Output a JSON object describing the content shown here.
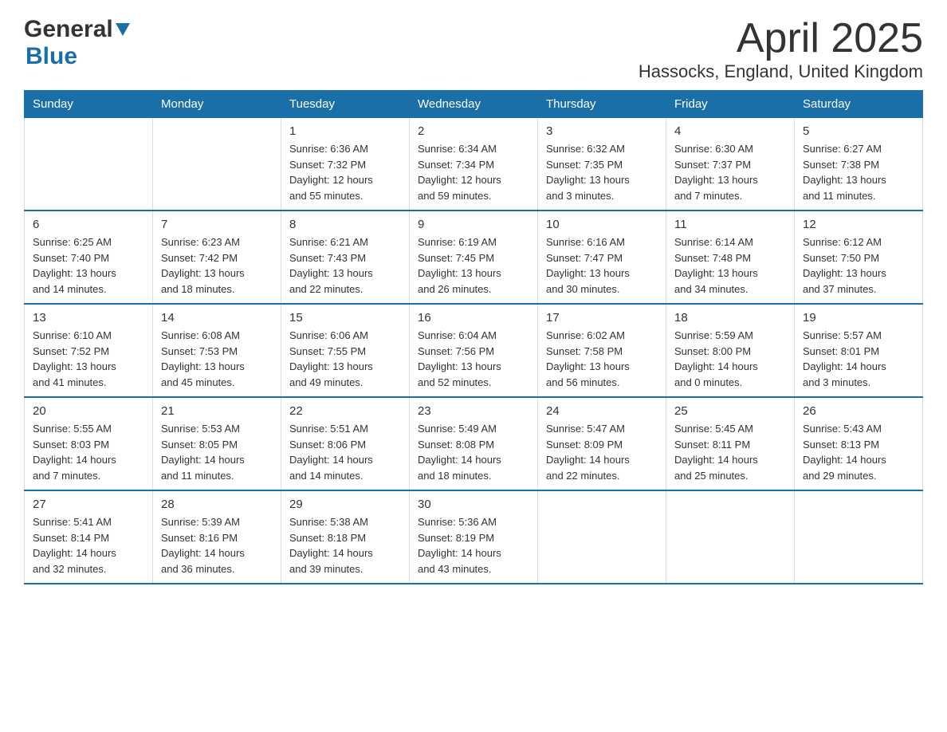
{
  "header": {
    "logo": {
      "general_text": "General",
      "blue_text": "Blue"
    },
    "title": "April 2025",
    "subtitle": "Hassocks, England, United Kingdom"
  },
  "calendar": {
    "days_of_week": [
      "Sunday",
      "Monday",
      "Tuesday",
      "Wednesday",
      "Thursday",
      "Friday",
      "Saturday"
    ],
    "weeks": [
      [
        {
          "day": "",
          "info": ""
        },
        {
          "day": "",
          "info": ""
        },
        {
          "day": "1",
          "info": "Sunrise: 6:36 AM\nSunset: 7:32 PM\nDaylight: 12 hours\nand 55 minutes."
        },
        {
          "day": "2",
          "info": "Sunrise: 6:34 AM\nSunset: 7:34 PM\nDaylight: 12 hours\nand 59 minutes."
        },
        {
          "day": "3",
          "info": "Sunrise: 6:32 AM\nSunset: 7:35 PM\nDaylight: 13 hours\nand 3 minutes."
        },
        {
          "day": "4",
          "info": "Sunrise: 6:30 AM\nSunset: 7:37 PM\nDaylight: 13 hours\nand 7 minutes."
        },
        {
          "day": "5",
          "info": "Sunrise: 6:27 AM\nSunset: 7:38 PM\nDaylight: 13 hours\nand 11 minutes."
        }
      ],
      [
        {
          "day": "6",
          "info": "Sunrise: 6:25 AM\nSunset: 7:40 PM\nDaylight: 13 hours\nand 14 minutes."
        },
        {
          "day": "7",
          "info": "Sunrise: 6:23 AM\nSunset: 7:42 PM\nDaylight: 13 hours\nand 18 minutes."
        },
        {
          "day": "8",
          "info": "Sunrise: 6:21 AM\nSunset: 7:43 PM\nDaylight: 13 hours\nand 22 minutes."
        },
        {
          "day": "9",
          "info": "Sunrise: 6:19 AM\nSunset: 7:45 PM\nDaylight: 13 hours\nand 26 minutes."
        },
        {
          "day": "10",
          "info": "Sunrise: 6:16 AM\nSunset: 7:47 PM\nDaylight: 13 hours\nand 30 minutes."
        },
        {
          "day": "11",
          "info": "Sunrise: 6:14 AM\nSunset: 7:48 PM\nDaylight: 13 hours\nand 34 minutes."
        },
        {
          "day": "12",
          "info": "Sunrise: 6:12 AM\nSunset: 7:50 PM\nDaylight: 13 hours\nand 37 minutes."
        }
      ],
      [
        {
          "day": "13",
          "info": "Sunrise: 6:10 AM\nSunset: 7:52 PM\nDaylight: 13 hours\nand 41 minutes."
        },
        {
          "day": "14",
          "info": "Sunrise: 6:08 AM\nSunset: 7:53 PM\nDaylight: 13 hours\nand 45 minutes."
        },
        {
          "day": "15",
          "info": "Sunrise: 6:06 AM\nSunset: 7:55 PM\nDaylight: 13 hours\nand 49 minutes."
        },
        {
          "day": "16",
          "info": "Sunrise: 6:04 AM\nSunset: 7:56 PM\nDaylight: 13 hours\nand 52 minutes."
        },
        {
          "day": "17",
          "info": "Sunrise: 6:02 AM\nSunset: 7:58 PM\nDaylight: 13 hours\nand 56 minutes."
        },
        {
          "day": "18",
          "info": "Sunrise: 5:59 AM\nSunset: 8:00 PM\nDaylight: 14 hours\nand 0 minutes."
        },
        {
          "day": "19",
          "info": "Sunrise: 5:57 AM\nSunset: 8:01 PM\nDaylight: 14 hours\nand 3 minutes."
        }
      ],
      [
        {
          "day": "20",
          "info": "Sunrise: 5:55 AM\nSunset: 8:03 PM\nDaylight: 14 hours\nand 7 minutes."
        },
        {
          "day": "21",
          "info": "Sunrise: 5:53 AM\nSunset: 8:05 PM\nDaylight: 14 hours\nand 11 minutes."
        },
        {
          "day": "22",
          "info": "Sunrise: 5:51 AM\nSunset: 8:06 PM\nDaylight: 14 hours\nand 14 minutes."
        },
        {
          "day": "23",
          "info": "Sunrise: 5:49 AM\nSunset: 8:08 PM\nDaylight: 14 hours\nand 18 minutes."
        },
        {
          "day": "24",
          "info": "Sunrise: 5:47 AM\nSunset: 8:09 PM\nDaylight: 14 hours\nand 22 minutes."
        },
        {
          "day": "25",
          "info": "Sunrise: 5:45 AM\nSunset: 8:11 PM\nDaylight: 14 hours\nand 25 minutes."
        },
        {
          "day": "26",
          "info": "Sunrise: 5:43 AM\nSunset: 8:13 PM\nDaylight: 14 hours\nand 29 minutes."
        }
      ],
      [
        {
          "day": "27",
          "info": "Sunrise: 5:41 AM\nSunset: 8:14 PM\nDaylight: 14 hours\nand 32 minutes."
        },
        {
          "day": "28",
          "info": "Sunrise: 5:39 AM\nSunset: 8:16 PM\nDaylight: 14 hours\nand 36 minutes."
        },
        {
          "day": "29",
          "info": "Sunrise: 5:38 AM\nSunset: 8:18 PM\nDaylight: 14 hours\nand 39 minutes."
        },
        {
          "day": "30",
          "info": "Sunrise: 5:36 AM\nSunset: 8:19 PM\nDaylight: 14 hours\nand 43 minutes."
        },
        {
          "day": "",
          "info": ""
        },
        {
          "day": "",
          "info": ""
        },
        {
          "day": "",
          "info": ""
        }
      ]
    ]
  }
}
